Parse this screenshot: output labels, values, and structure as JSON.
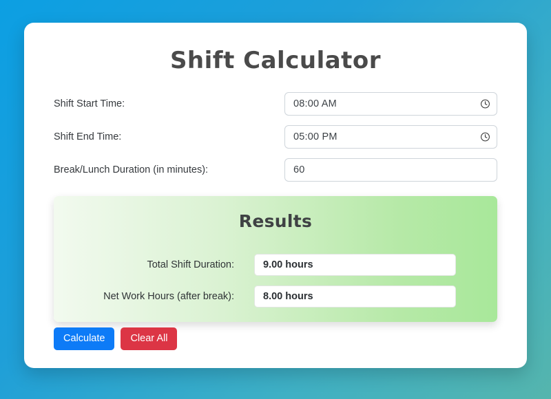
{
  "theme": {
    "background_from": "#0c9fe3",
    "background_to": "#55b5ad",
    "card_background": "#ffffff",
    "results_from": "#f2faef",
    "results_to": "#a8e89a",
    "primary_button": "#0d7bf7",
    "danger_button": "#dc3545"
  },
  "card": {
    "title": "Shift Calculator"
  },
  "form": {
    "fields": [
      {
        "label": "Shift Start Time:",
        "value": "08:00 AM",
        "type": "time",
        "icon": "clock-icon"
      },
      {
        "label": "Shift End Time:",
        "value": "05:00 PM",
        "type": "time",
        "icon": "clock-icon"
      },
      {
        "label": "Break/Lunch Duration (in minutes):",
        "value": "60",
        "type": "number",
        "icon": ""
      }
    ]
  },
  "results": {
    "title": "Results",
    "rows": [
      {
        "label": "Total Shift Duration:",
        "value": "9.00 hours"
      },
      {
        "label": "Net Work Hours (after break):",
        "value": "8.00 hours"
      }
    ]
  },
  "actions": {
    "calculate_label": "Calculate",
    "clear_label": "Clear All"
  }
}
